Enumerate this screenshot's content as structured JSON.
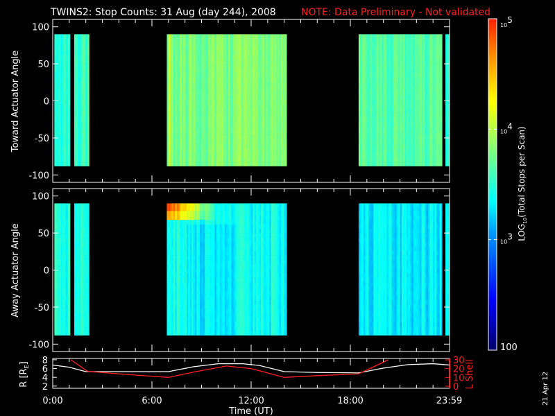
{
  "title": {
    "main": "TWINS2: Stop Counts: 31 Aug (day 244), 2008",
    "note": "NOTE: Data Preliminary - Not validated",
    "note_color": "#ff2020"
  },
  "date_stamp": "21 Apr 12",
  "chart_data": [
    {
      "type": "heatmap",
      "name": "toward",
      "ylabel": "Toward Actuator Angle",
      "ylim": [
        -110,
        110
      ],
      "yticks": [
        "100",
        "50",
        "0",
        "-50",
        "-100"
      ],
      "ytick_values": [
        100,
        50,
        0,
        -50,
        -100
      ],
      "angle_range": [
        -88,
        90
      ],
      "xlim_hours": [
        0,
        24
      ],
      "segments": [
        {
          "start": 0.1,
          "end": 1.05,
          "log_level": 3.5,
          "hot_band": false
        },
        {
          "start": 1.3,
          "end": 2.2,
          "log_level": 3.55,
          "hot_band": false
        },
        {
          "start": 6.9,
          "end": 14.15,
          "log_level": 3.8,
          "hot_band": false
        },
        {
          "start": 18.5,
          "end": 23.55,
          "log_level": 3.65,
          "hot_band": false
        },
        {
          "start": 23.75,
          "end": 24.0,
          "log_level": 3.5,
          "hot_band": false
        }
      ]
    },
    {
      "type": "heatmap",
      "name": "away",
      "ylabel": "Away Actuator Angle",
      "ylim": [
        -110,
        110
      ],
      "yticks": [
        "100",
        "50",
        "0",
        "-50",
        "-100"
      ],
      "ytick_values": [
        100,
        50,
        0,
        -50,
        -100
      ],
      "angle_range": [
        -88,
        90
      ],
      "xlim_hours": [
        0,
        24
      ],
      "segments": [
        {
          "start": 0.1,
          "end": 1.05,
          "log_level": 3.45,
          "hot_band": false
        },
        {
          "start": 1.3,
          "end": 2.2,
          "log_level": 3.5,
          "hot_band": false
        },
        {
          "start": 6.9,
          "end": 14.15,
          "log_level": 3.4,
          "hot_band": true
        },
        {
          "start": 18.5,
          "end": 23.55,
          "log_level": 3.3,
          "hot_band": false
        },
        {
          "start": 23.75,
          "end": 24.0,
          "log_level": 3.45,
          "hot_band": false
        }
      ]
    },
    {
      "type": "line",
      "name": "orbit",
      "ylabel_left": "R [R",
      "ylabel_left_sub": "E",
      "ylabel_left_end": "]",
      "ylabel_right": "L Shell",
      "ylim_left": [
        1.5,
        8.3
      ],
      "ylim_right": [
        0,
        30
      ],
      "yticks_left": [
        "8",
        "6",
        "4",
        "2"
      ],
      "yticks_left_values": [
        8,
        6,
        4,
        2
      ],
      "yticks_right": [
        "30",
        "20",
        "10",
        "0"
      ],
      "yticks_right_values": [
        30,
        20,
        10,
        0
      ],
      "xlabel": "Time (UT)",
      "xticks": [
        "0:00",
        "6:00",
        "12:00",
        "18:00",
        "23:59"
      ],
      "xtick_hours": [
        0,
        6,
        12,
        18,
        23.98
      ],
      "series": [
        {
          "name": "R",
          "color": "#ffffff",
          "axis": "left",
          "x": [
            0,
            1,
            2,
            4,
            7,
            8.5,
            10,
            11.5,
            12.5,
            14,
            16,
            18.5,
            20,
            21.5,
            23,
            24
          ],
          "y": [
            6.8,
            6.3,
            5.3,
            5.3,
            5.3,
            6.4,
            7.1,
            7.1,
            6.7,
            5.3,
            5.1,
            5.0,
            6.1,
            6.9,
            7.1,
            6.8
          ]
        },
        {
          "name": "L Shell",
          "color": "#ff2020",
          "axis": "right",
          "x": [
            1.1,
            2.1,
            4,
            7,
            8.5,
            10.5,
            12,
            14,
            16,
            18.5,
            20.3
          ],
          "y": [
            30,
            17,
            14,
            10,
            16,
            23,
            20,
            10,
            12,
            14,
            30
          ]
        }
      ]
    }
  ],
  "colorbar": {
    "label": "LOG",
    "label_sub": "10",
    "label_rest": "(Total Stops per Scan)",
    "ticks": [
      {
        "base": "10",
        "exp": "5",
        "value": 100000
      },
      {
        "base": "10",
        "exp": "4",
        "value": 10000
      },
      {
        "base": "10",
        "exp": "3",
        "value": 1000
      },
      {
        "base": "100",
        "exp": "",
        "value": 100
      }
    ],
    "range_log": [
      2,
      5
    ]
  }
}
